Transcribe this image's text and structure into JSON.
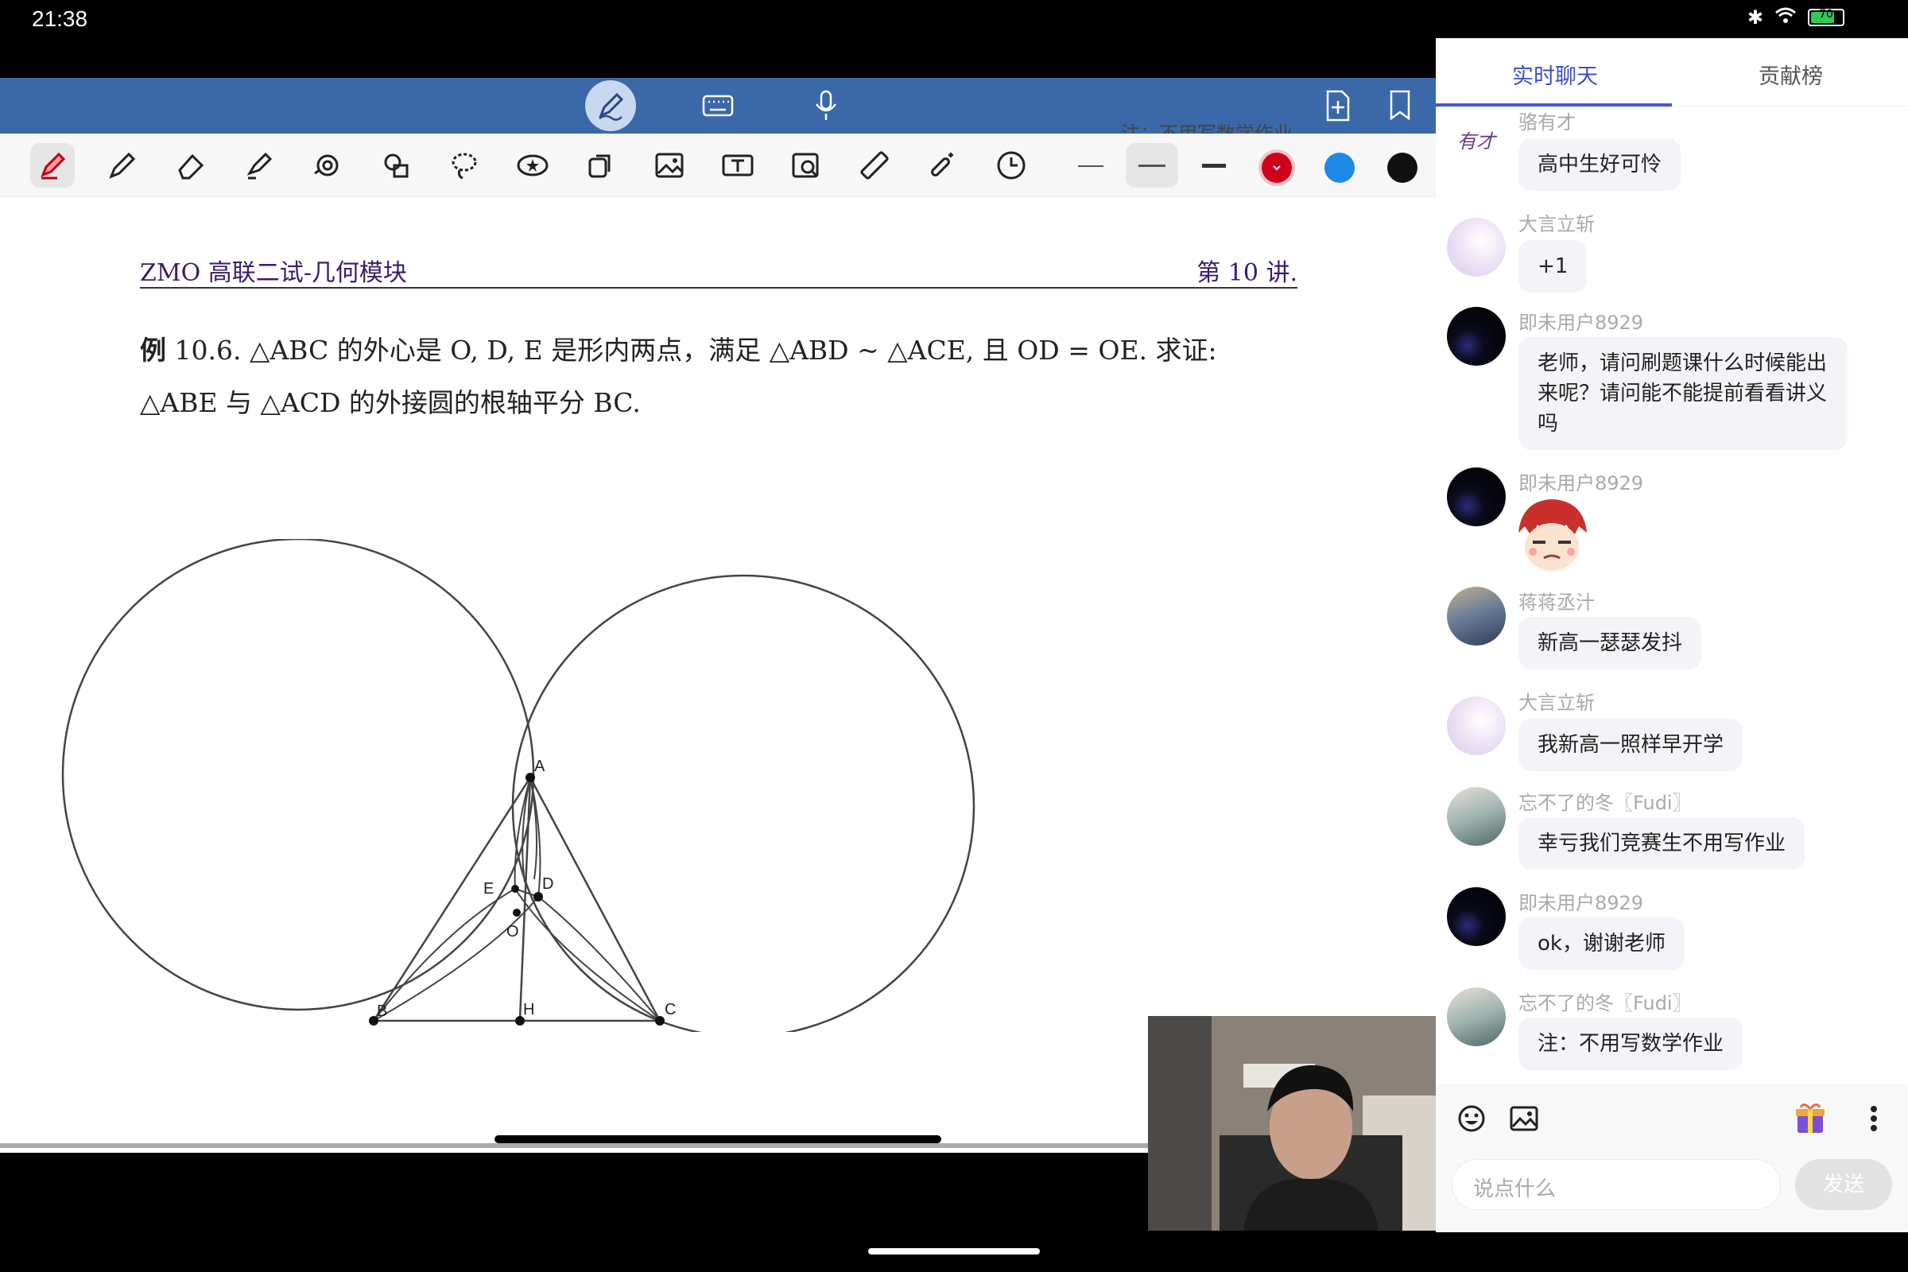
{
  "status": {
    "time": "21:38",
    "battery": "70"
  },
  "doc": {
    "header_left": "ZMO 高联二试-几何模块",
    "header_right": "第 10 讲.",
    "problem_label": "例",
    "problem_line1": "10.6. △ABC 的外心是 O, D, E 是形内两点，满足 △ABD ~ △ACE, 且 OD = OE. 求证:",
    "problem_line2": "△ABE 与 △ACD 的外接圆的根轴平分 BC.",
    "overlay_note": "注：不用写数学作业",
    "points": {
      "A": "A",
      "B": "B",
      "C": "C",
      "D": "D",
      "E": "E",
      "O": "O",
      "H": "H"
    }
  },
  "colors": {
    "topbar": "#3a68a8",
    "red": "#d0021b",
    "blue": "#1e88e5",
    "black": "#111111",
    "accent": "#3b4fc8"
  },
  "chat": {
    "tabs": [
      {
        "label": "实时聊天"
      },
      {
        "label": "贡献榜"
      }
    ],
    "messages": [
      {
        "user": "骆有才",
        "text": "高中生好可怜"
      },
      {
        "user": "大言立斩",
        "text": "+1"
      },
      {
        "user": "即未用户8929",
        "text": "老师，请问刷题课什么时候能出来呢？请问能不能提前看看讲义吗"
      },
      {
        "user": "即未用户8929",
        "text": ""
      },
      {
        "user": "蒋蒋丞汁",
        "text": "新高一瑟瑟发抖"
      },
      {
        "user": "大言立斩",
        "text": "我新高一照样早开学"
      },
      {
        "user": "忘不了的冬〖Fudi〗",
        "text": "幸亏我们竞赛生不用写作业"
      },
      {
        "user": "即未用户8929",
        "text": "ok，谢谢老师"
      },
      {
        "user": "忘不了的冬〖Fudi〗",
        "text": "注：不用写数学作业"
      }
    ],
    "avatar_text_first": "有才",
    "input_placeholder": "说点什么",
    "send_label": "发送"
  }
}
